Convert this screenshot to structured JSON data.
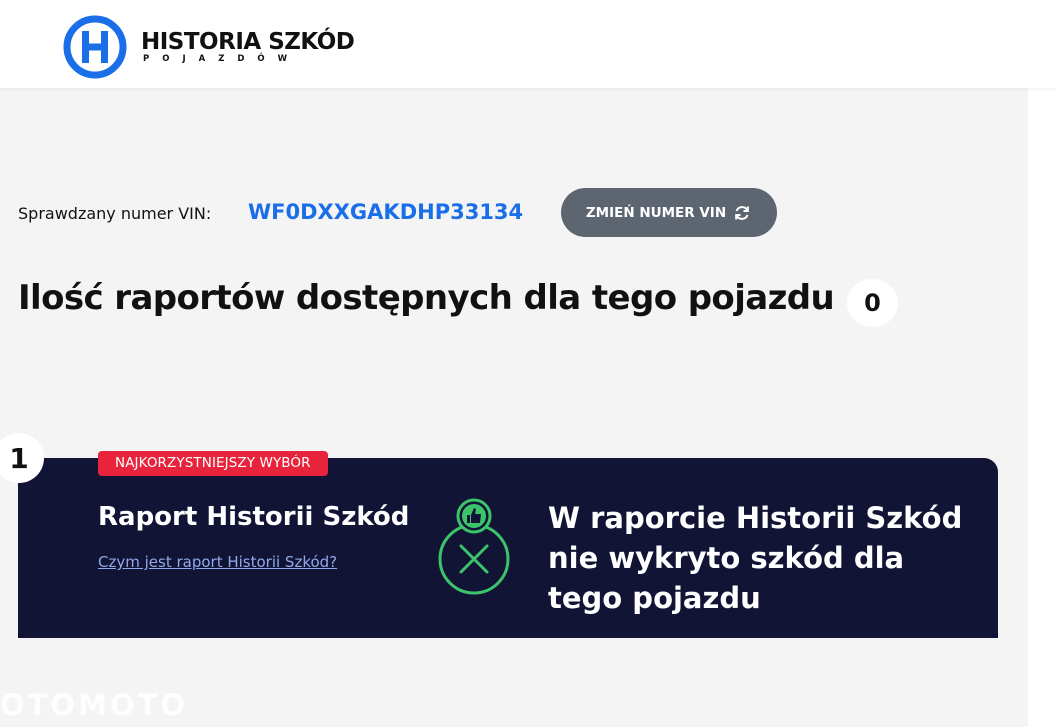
{
  "header": {
    "logo_title": "HISTORIA SZKÓD",
    "logo_subtitle": "POJAZDÓW"
  },
  "vin": {
    "label": "Sprawdzany numer VIN:",
    "value": "WF0DXXGAKDHP33134",
    "change_button": "ZMIEŃ NUMER VIN"
  },
  "reports": {
    "title": "Ilość raportów dostępnych dla tego pojazdu",
    "count": "0"
  },
  "report_card": {
    "number": "1",
    "badge": "NAJKORZYSTNIEJSZY WYBÓR",
    "title": "Raport Historii Szkód",
    "link": "Czym jest raport Historii Szkód?",
    "status": "W raporcie Historii Szkód nie wykryto szkód dla tego pojazdu"
  },
  "watermark": "OTOMOTO",
  "colors": {
    "accent_blue": "#1a6ee8",
    "card_bg": "#121436",
    "badge_red": "#e8243c",
    "status_green": "#3cc46a",
    "button_gray": "#5d6570"
  },
  "icons": [
    "logo-icon",
    "refresh-icon",
    "thumbs-up-icon",
    "x-circle-icon"
  ]
}
